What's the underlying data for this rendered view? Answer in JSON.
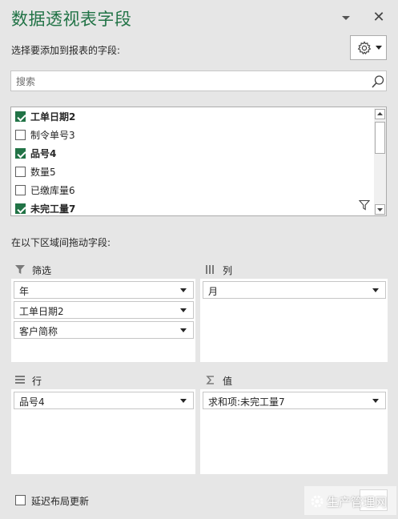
{
  "pane": {
    "title": "数据透视表字段",
    "choose_label": "选择要添加到报表的字段:",
    "close_glyph": "✕"
  },
  "search": {
    "placeholder": "搜索",
    "value": ""
  },
  "fields": [
    {
      "label": "工单日期2",
      "checked": true
    },
    {
      "label": "制令单号3",
      "checked": false
    },
    {
      "label": "品号4",
      "checked": true
    },
    {
      "label": "数量5",
      "checked": false
    },
    {
      "label": "已缴库量6",
      "checked": false
    },
    {
      "label": "未完工量7",
      "checked": true
    }
  ],
  "areas": {
    "drag_label": "在以下区域间拖动字段:",
    "filters": {
      "title": "筛选",
      "items": [
        "年",
        "工单日期2",
        "客户简称"
      ]
    },
    "columns": {
      "title": "列",
      "items": [
        "月"
      ]
    },
    "rows": {
      "title": "行",
      "items": [
        "品号4"
      ]
    },
    "values": {
      "title": "值",
      "items": [
        "求和项:未完工量7"
      ]
    }
  },
  "footer": {
    "defer_label": "延迟布局更新",
    "defer_checked": false,
    "watermark": "生产管理网"
  },
  "colors": {
    "accent": "#217346",
    "pane_bg": "#e6e6e6"
  }
}
